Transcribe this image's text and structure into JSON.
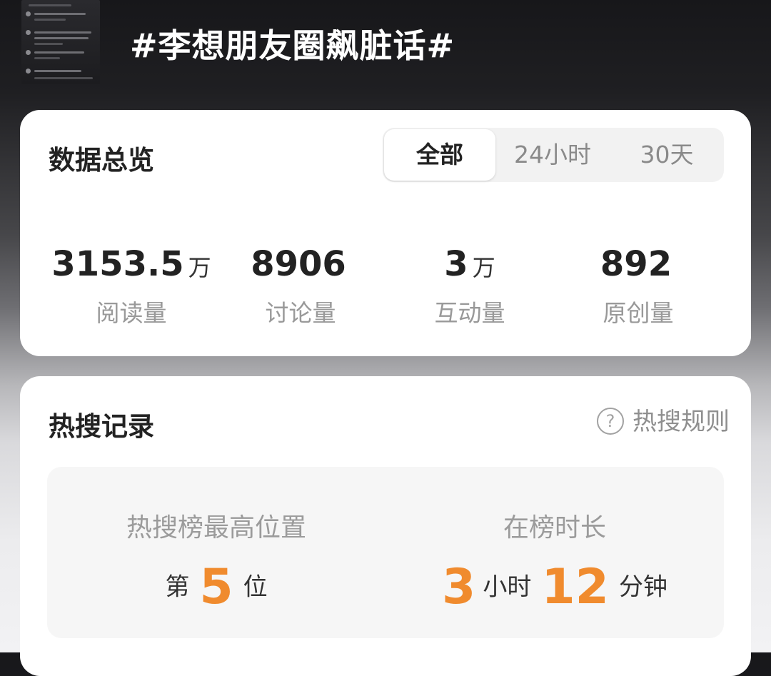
{
  "header": {
    "title": "#李想朋友圈飙脏话#"
  },
  "overview": {
    "title": "数据总览",
    "tabs": [
      {
        "label": "全部",
        "selected": true
      },
      {
        "label": "24小时",
        "selected": false
      },
      {
        "label": "30天",
        "selected": false
      }
    ],
    "stats": [
      {
        "value": "3153.5",
        "unit": "万",
        "label": "阅读量"
      },
      {
        "value": "8906",
        "unit": "",
        "label": "讨论量"
      },
      {
        "value": "3",
        "unit": "万",
        "label": "互动量"
      },
      {
        "value": "892",
        "unit": "",
        "label": "原创量"
      }
    ]
  },
  "hot_search": {
    "title": "热搜记录",
    "rules_label": "热搜规则",
    "rules_icon": "help-circle-icon",
    "highest_position": {
      "title": "热搜榜最高位置",
      "prefix": "第",
      "value": "5",
      "suffix": "位"
    },
    "duration": {
      "title": "在榜时长",
      "hours": "3",
      "hours_unit": "小时",
      "minutes": "12",
      "minutes_unit": "分钟"
    }
  },
  "colors": {
    "accent_orange": "#f08b2e",
    "text_dark": "#222222",
    "text_muted": "#999999",
    "card_bg": "#ffffff"
  }
}
